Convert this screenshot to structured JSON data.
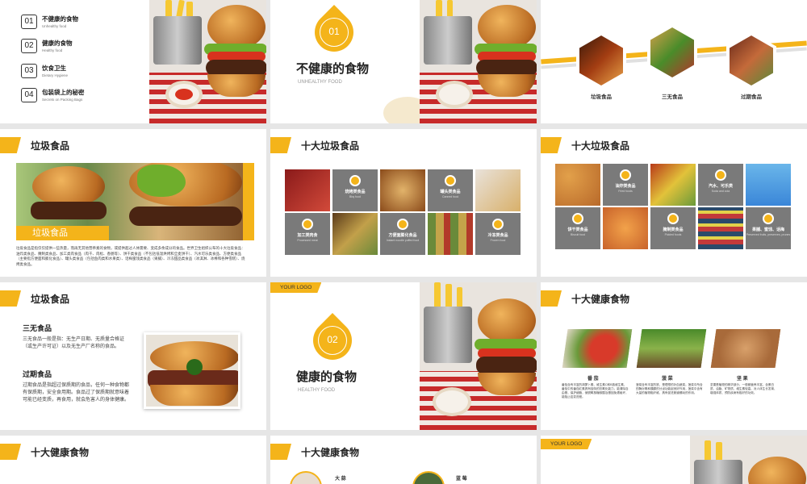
{
  "colors": {
    "accent": "#f4b41a",
    "gray_tile": "#7a7a7a",
    "page_bg": "#e6e6e6"
  },
  "toc": [
    {
      "num": "01",
      "zh": "不健康的食物",
      "en": "Unhealthy food"
    },
    {
      "num": "02",
      "zh": "健康的食物",
      "en": "Healthy food"
    },
    {
      "num": "03",
      "zh": "饮食卫生",
      "en": "Dietary Hygiene"
    },
    {
      "num": "04",
      "zh": "包装袋上的秘密",
      "en": "Secrets on Packing Bags"
    }
  ],
  "section1": {
    "num": "01",
    "title": "不健康的食物",
    "sub": "UNHEALTHY FOOD"
  },
  "hex_captions": [
    "垃圾食品",
    "三无食品",
    "过期食品"
  ],
  "slide4": {
    "title": "垃圾食品",
    "bar": "垃圾食品",
    "para": "垃圾食品是指仅仅提供一些热量，而再无其他营养素的食物，或提供超过人体需要、变成多余成分的食品。世界卫生组织公布的十大垃圾食品：油炸类食品、腌制类食品、加工类肉食品（肉干、肉松、香肠等）、饼干类食品（不包括低温烘烤和全麦饼干）、汽水可乐类食品、方便类食品（主要指方便面和膨化食品）、罐头类食品（包括鱼肉类和水果类）、话梅蜜饯类食品（果脯）、冷冻甜品类食品（冰淇淋、冰棒和各种雪糕）、烧烤类食品。"
  },
  "slide5": {
    "title": "十大垃圾食品",
    "tiles": [
      {
        "zh": "烧烤类食品",
        "en": "Bbq food"
      },
      {
        "zh": "罐头类食品",
        "en": "Canned food"
      },
      {
        "zh": "加工类肉食",
        "en": "Processed meat"
      },
      {
        "zh": "方便面膨化食品",
        "en": "Instant noodle puffed food"
      },
      {
        "zh": "冷冻类食品",
        "en": "Frozen food"
      }
    ]
  },
  "slide6": {
    "title": "十大垃圾食品",
    "tiles": [
      {
        "zh": "油炸类食品",
        "en": "Fried foods"
      },
      {
        "zh": "汽水、可乐类",
        "en": "Soda and cola"
      },
      {
        "zh": "饼干类食品",
        "en": "Biscuit food"
      },
      {
        "zh": "腌制类食品",
        "en": "Pickled foods"
      },
      {
        "zh": "果脯、蜜饯、话梅",
        "en": "Preserved fruits, preserves, prunes"
      }
    ]
  },
  "slide7": {
    "title": "垃圾食品",
    "h1": "三无食品",
    "p1": "三无食品一般是指：无生产日期、无质量合格证（或生产许可证）以及无生产厂名称的食品。",
    "h2": "过期食品",
    "p2": "过期食品是指超过保质期的食品，任何一种食物都有保质期，安全食用期。食品过了保质期就意味着可能已经变质，再食用，就会危害人的身体健康。"
  },
  "section2": {
    "logo": "YOUR LOGO",
    "num": "02",
    "title": "健康的食物",
    "sub": "HEALTHY FOOD"
  },
  "slide9": {
    "title": "十大健康食物",
    "items": [
      {
        "name": "番 茄",
        "desc": "番茄含有丰富的胡萝卜素、维生素C和B族维生素，番茄中的番茄红素具有独特的抗氧化能力，能清除自由基，保护细胞，使脱氧核糖核酸及基因免遭破坏，能阻止癌变进程。"
      },
      {
        "name": "菠 菜",
        "desc": "菠菜含有丰富的铁，是理想的补血蔬菜。菠菜中所含的酶对胃和胰腺的分泌功能起良好作用，菠菜中含有大量的植物粗纤维，具有促进肠道蠕动的作用。"
      },
      {
        "name": "坚 果",
        "desc": "坚果是植物的精华部分，一般都营养丰富，含蛋白质、油脂、矿物质、维生素较高，对人体生长发育、增强体质、预防疾病有极好的功效。"
      }
    ]
  },
  "slide10": {
    "title": "十大健康食物"
  },
  "slide11": {
    "title": "十大健康食物",
    "items": [
      "大 蒜",
      "蓝 莓"
    ]
  },
  "slide12": {
    "logo": "YOUR LOGO"
  }
}
